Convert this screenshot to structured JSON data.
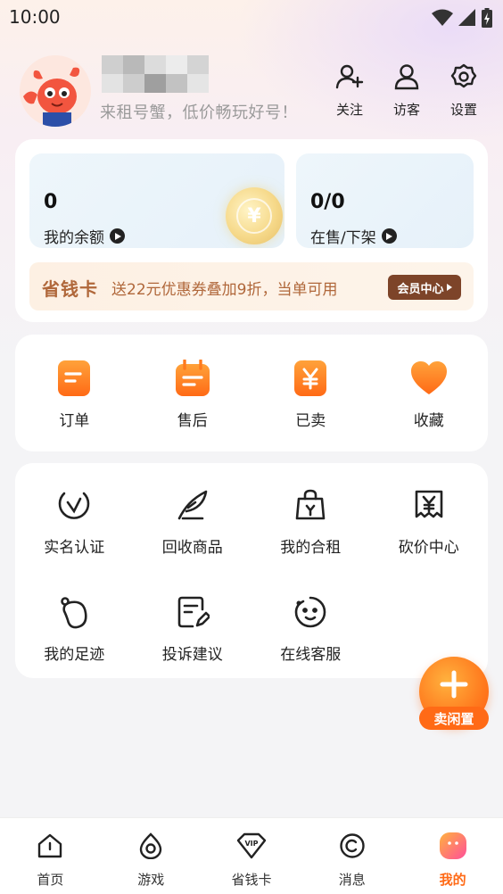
{
  "status_bar": {
    "time": "10:00"
  },
  "profile": {
    "slogan": "来租号蟹，低价畅玩好号！",
    "actions": [
      {
        "label": "关注",
        "icon": "add-user-icon"
      },
      {
        "label": "访客",
        "icon": "user-icon"
      },
      {
        "label": "设置",
        "icon": "gear-icon"
      }
    ]
  },
  "wallet": {
    "balance_value": "0",
    "balance_label": "我的余额",
    "onsale_value": "0/0",
    "onsale_label": "在售/下架"
  },
  "save_card": {
    "title": "省钱卡",
    "desc": "送22元优惠券叠加9折，当单可用",
    "button": "会员中心"
  },
  "orders": [
    {
      "label": "订单",
      "icon": "order-icon"
    },
    {
      "label": "售后",
      "icon": "calendar-icon"
    },
    {
      "label": "已卖",
      "icon": "yen-tag-icon"
    },
    {
      "label": "收藏",
      "icon": "heart-icon"
    }
  ],
  "services": [
    {
      "label": "实名认证",
      "icon": "verify-icon"
    },
    {
      "label": "回收商品",
      "icon": "feather-icon"
    },
    {
      "label": "我的合租",
      "icon": "bag-icon"
    },
    {
      "label": "砍价中心",
      "icon": "yen-ticket-icon"
    },
    {
      "label": "我的足迹",
      "icon": "footprint-icon"
    },
    {
      "label": "投诉建议",
      "icon": "edit-note-icon"
    },
    {
      "label": "在线客服",
      "icon": "service-face-icon"
    }
  ],
  "sell_button": {
    "label": "卖闲置"
  },
  "bottom_nav": [
    {
      "label": "首页",
      "icon": "home-icon"
    },
    {
      "label": "游戏",
      "icon": "game-icon"
    },
    {
      "label": "省钱卡",
      "icon": "vip-icon"
    },
    {
      "label": "消息",
      "icon": "message-icon"
    },
    {
      "label": "我的",
      "icon": "me-icon",
      "active": true
    }
  ],
  "colors": {
    "accent": "#ff6a16",
    "save_text": "#b0673a",
    "vip_button": "#7d4429"
  }
}
